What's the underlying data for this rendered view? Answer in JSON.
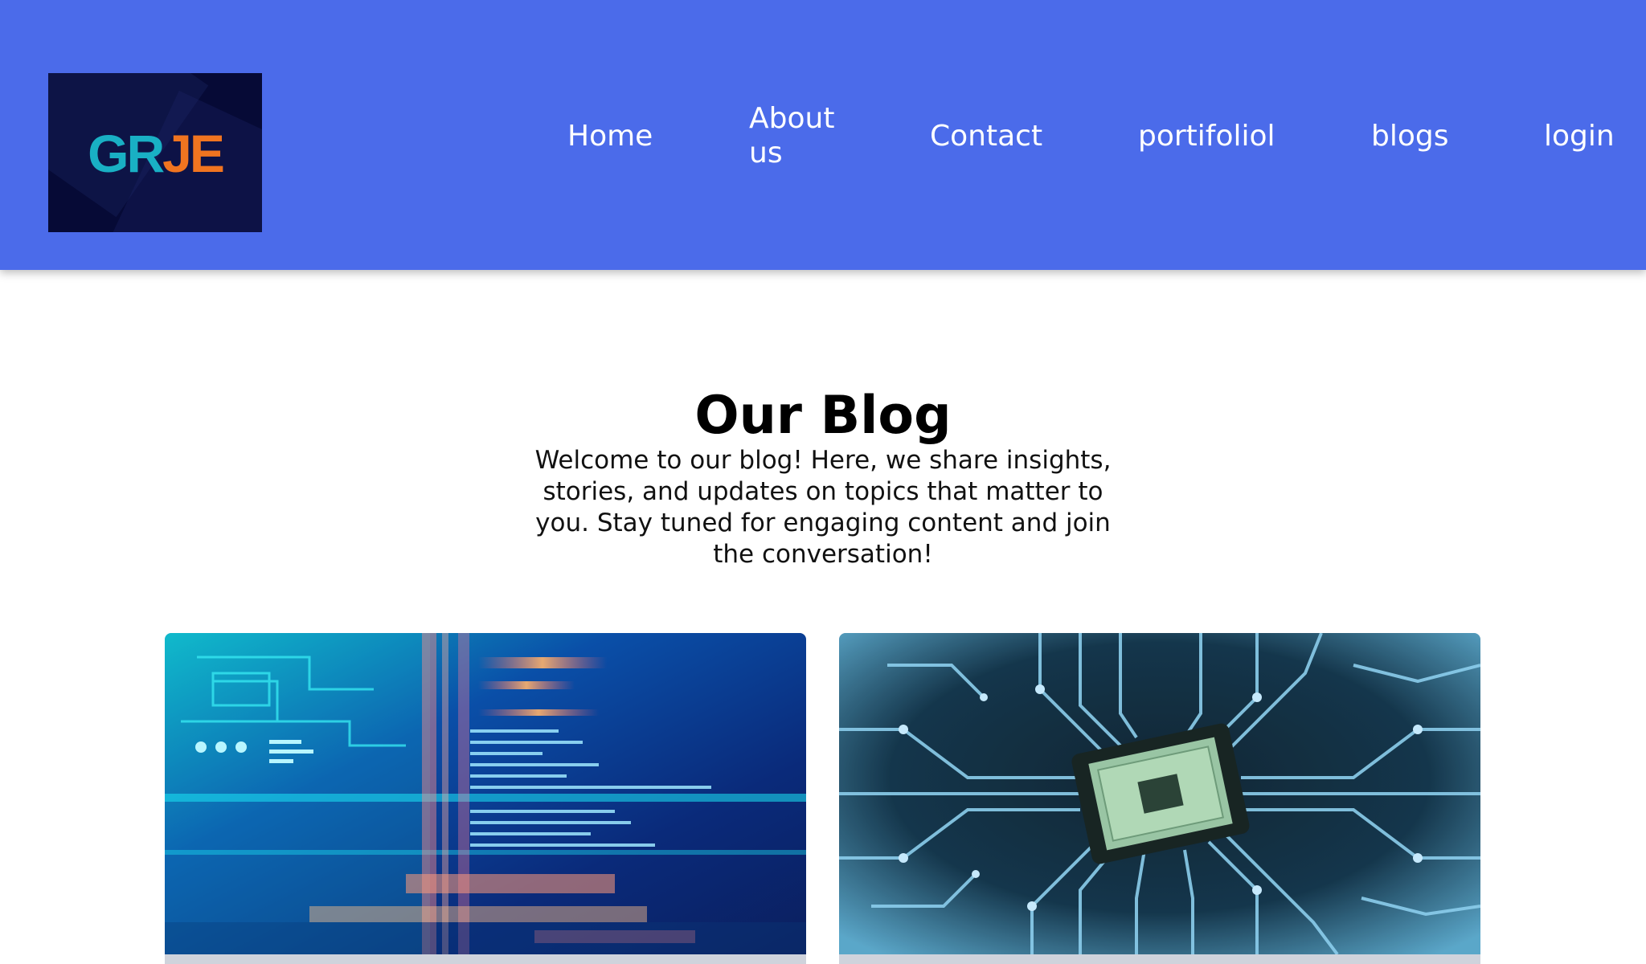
{
  "brand": {
    "logo_first": "GR",
    "logo_second": "JE",
    "logo_colors": {
      "first": "#19b0c4",
      "second": "#f07420",
      "background": "#060a36"
    }
  },
  "nav": {
    "items": [
      {
        "label": "Home"
      },
      {
        "label": "About us"
      },
      {
        "label": "Contact"
      },
      {
        "label": "portifoliol"
      },
      {
        "label": "blogs"
      },
      {
        "label": "login"
      }
    ]
  },
  "page": {
    "title": "Our Blog",
    "intro": "Welcome to our blog! Here, we share insights, stories, and updates on topics that matter to you. Stay tuned for engaging content and join the conversation!"
  },
  "posts": [
    {
      "image": "code-hud-image"
    },
    {
      "image": "circuit-chip-image"
    }
  ],
  "colors": {
    "header_bg": "#4b6bea",
    "nav_text": "#ffffff",
    "page_bg": "#ffffff"
  }
}
